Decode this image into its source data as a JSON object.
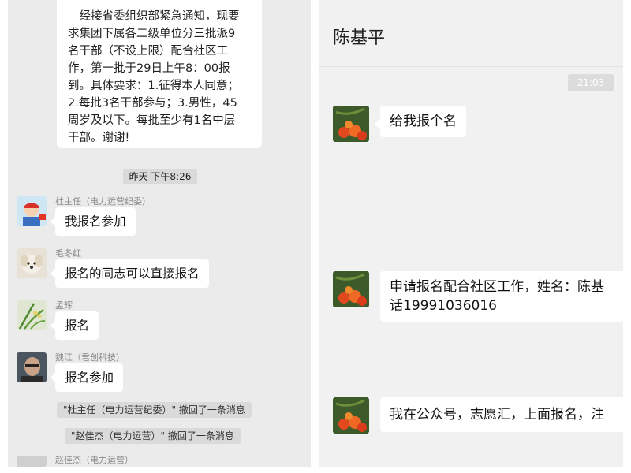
{
  "left_chat": {
    "notice_lines": [
      "　经接省委组织部紧急通知，现要",
      "求集团下属各二级单位分三批派9",
      "名干部（不设上限）配合社区工",
      "作，第一批于29日上午8：00报",
      "到。具体要求：1.征得本人同意；",
      "2.每批3名干部参与；3.男性，45",
      "周岁及以下。每批至少有1名中层",
      "干部。谢谢!"
    ],
    "timestamp": "昨天 下午8:26",
    "messages": [
      {
        "sender": "杜主任（电力运营纪委）",
        "text": "我报名参加",
        "avatar": "cartoon-worker-avatar"
      },
      {
        "sender": "毛冬红",
        "text": "报名的同志可以直接报名",
        "avatar": "puppy-avatar"
      },
      {
        "sender": "孟辉",
        "text": "报名",
        "avatar": "orchid-avatar"
      },
      {
        "sender": "魏江（君创科技）",
        "text": "报名参加",
        "avatar": "portrait-avatar"
      }
    ],
    "recalls": [
      "\"杜主任（电力运营纪委）\" 撤回了一条消息",
      "\"赵佳杰（电力运营）\" 撤回了一条消息"
    ],
    "last_sender": "赵佳杰（电力运营）"
  },
  "right_chat": {
    "title": "陈基平",
    "time": "21:03",
    "messages": [
      {
        "lines": [
          "给我报个名"
        ]
      },
      {
        "lines": [
          "申请报名配合社区工作，姓名：陈基",
          "话19991036016"
        ]
      },
      {
        "lines": [
          "我在公众号，志愿汇，上面报名，注"
        ]
      }
    ]
  },
  "colors": {
    "left_background": "#ebebeb",
    "right_background": "#f1f1f1",
    "bubble": "#ffffff",
    "system_chip": "#dadada"
  }
}
